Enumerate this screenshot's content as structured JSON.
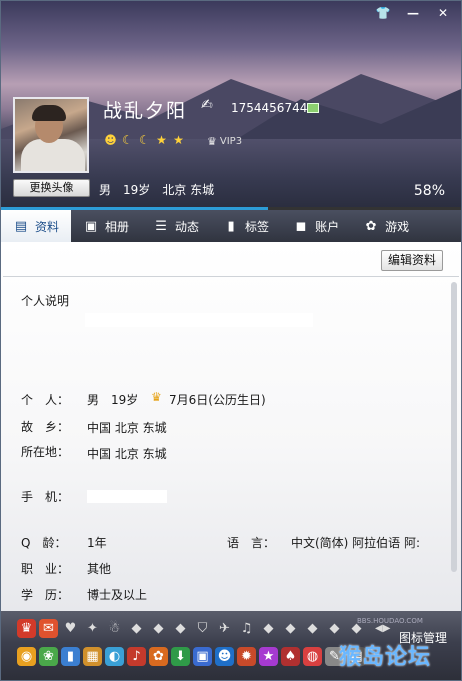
{
  "window": {
    "skin_icon": "shirt-icon",
    "minimize_label": "—",
    "close_label": "✕"
  },
  "profile": {
    "nickname": "战乱夕阳",
    "qq_number": "1754456744",
    "change_avatar_label": "更换头像",
    "gender": "男",
    "age": "19岁",
    "location": "北京 东城",
    "vip_label": "VIP3",
    "percent_label": "58%",
    "percent": 58,
    "level_icons": [
      "sun",
      "moon",
      "moon",
      "star",
      "star"
    ]
  },
  "tabs": [
    {
      "label": "资料",
      "icon": "id-card-icon",
      "active": true
    },
    {
      "label": "相册",
      "icon": "photo-icon",
      "active": false
    },
    {
      "label": "动态",
      "icon": "list-icon",
      "active": false
    },
    {
      "label": "标签",
      "icon": "bookmark-icon",
      "active": false
    },
    {
      "label": "账户",
      "icon": "briefcase-icon",
      "active": false
    },
    {
      "label": "游戏",
      "icon": "game-icon",
      "active": false
    }
  ],
  "content": {
    "edit_button": "编辑资料",
    "personal_desc_label": "个人说明",
    "person_label": "个　人：",
    "person_gender": "男",
    "person_age": "19岁",
    "birthday": "7月6日(公历生日)",
    "hometown_label": "故　乡：",
    "hometown": "中国 北京 东城",
    "location_label": "所在地：",
    "location": "中国 北京 东城",
    "phone_label": "手　机：",
    "qage_label": "Q　龄：",
    "qage": "1年",
    "language_label": "语　言：",
    "language": "中文(简体)  阿拉伯语  阿:",
    "job_label": "职　业：",
    "job": "其他",
    "edu_label": "学　历：",
    "edu": "博士及以上"
  },
  "iconbar": {
    "manage_label": "图标管理",
    "watermark": "猴岛论坛",
    "watermark_url": "BBS.HOUDAO.COM"
  },
  "colors": {
    "tab_bar": "#3a3e4b",
    "active_tab_text": "#1d4e8a",
    "progress": "#2d9cd6"
  }
}
